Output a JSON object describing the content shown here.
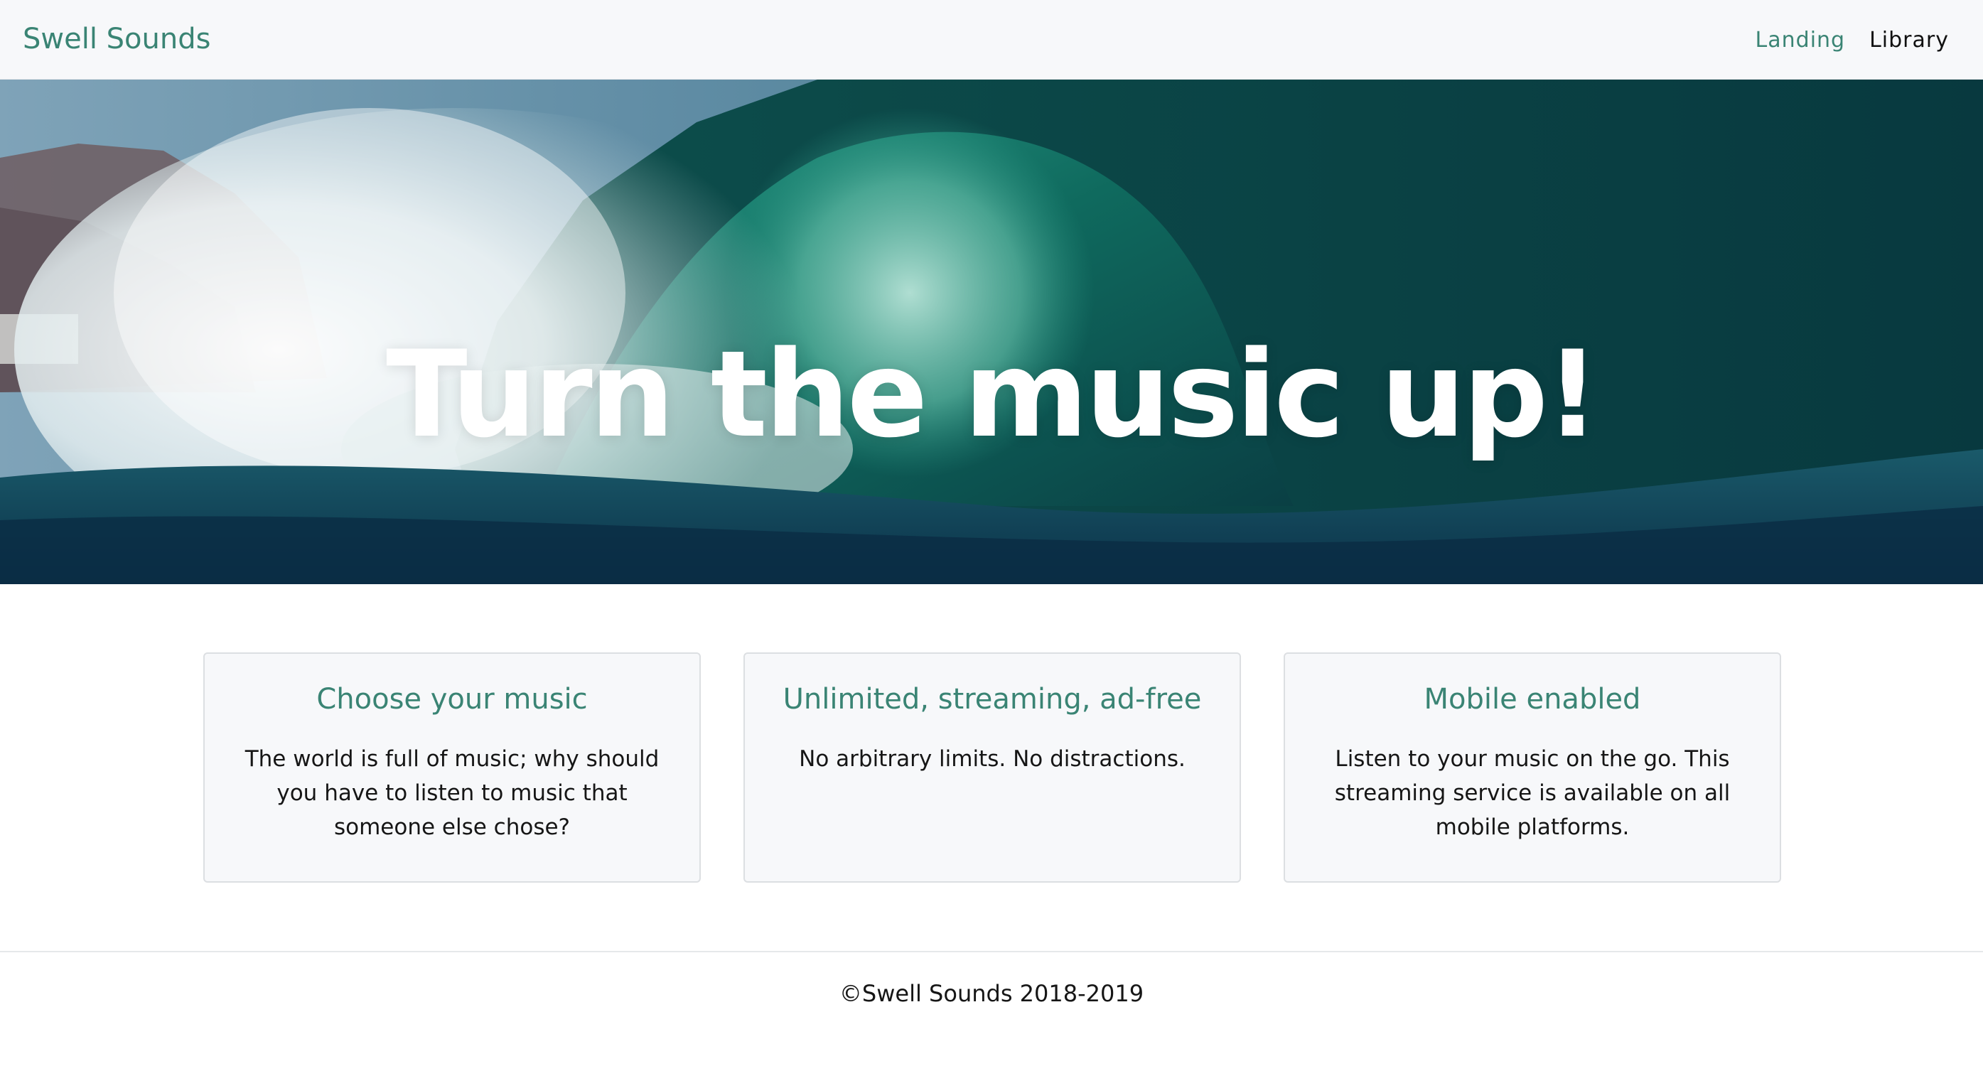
{
  "navbar": {
    "brand": "Swell Sounds",
    "links": [
      {
        "label": "Landing",
        "active": true
      },
      {
        "label": "Library",
        "active": false
      }
    ]
  },
  "hero": {
    "title": "Turn the music up!",
    "image": "ocean-wave-photo"
  },
  "features": [
    {
      "title": "Choose your music",
      "text": "The world is full of music; why should you have to listen to music that someone else chose?"
    },
    {
      "title": "Unlimited, streaming, ad-free",
      "text": "No arbitrary limits. No distractions."
    },
    {
      "title": "Mobile enabled",
      "text": "Listen to your music on the go. This streaming service is available on all mobile platforms."
    }
  ],
  "footer": {
    "copyright": "©Swell Sounds 2018-2019"
  },
  "colors": {
    "accent": "#3a8474",
    "navbar_bg": "#f7f8fa",
    "card_bg": "#f7f8fa",
    "card_border": "#dcdfe2"
  }
}
